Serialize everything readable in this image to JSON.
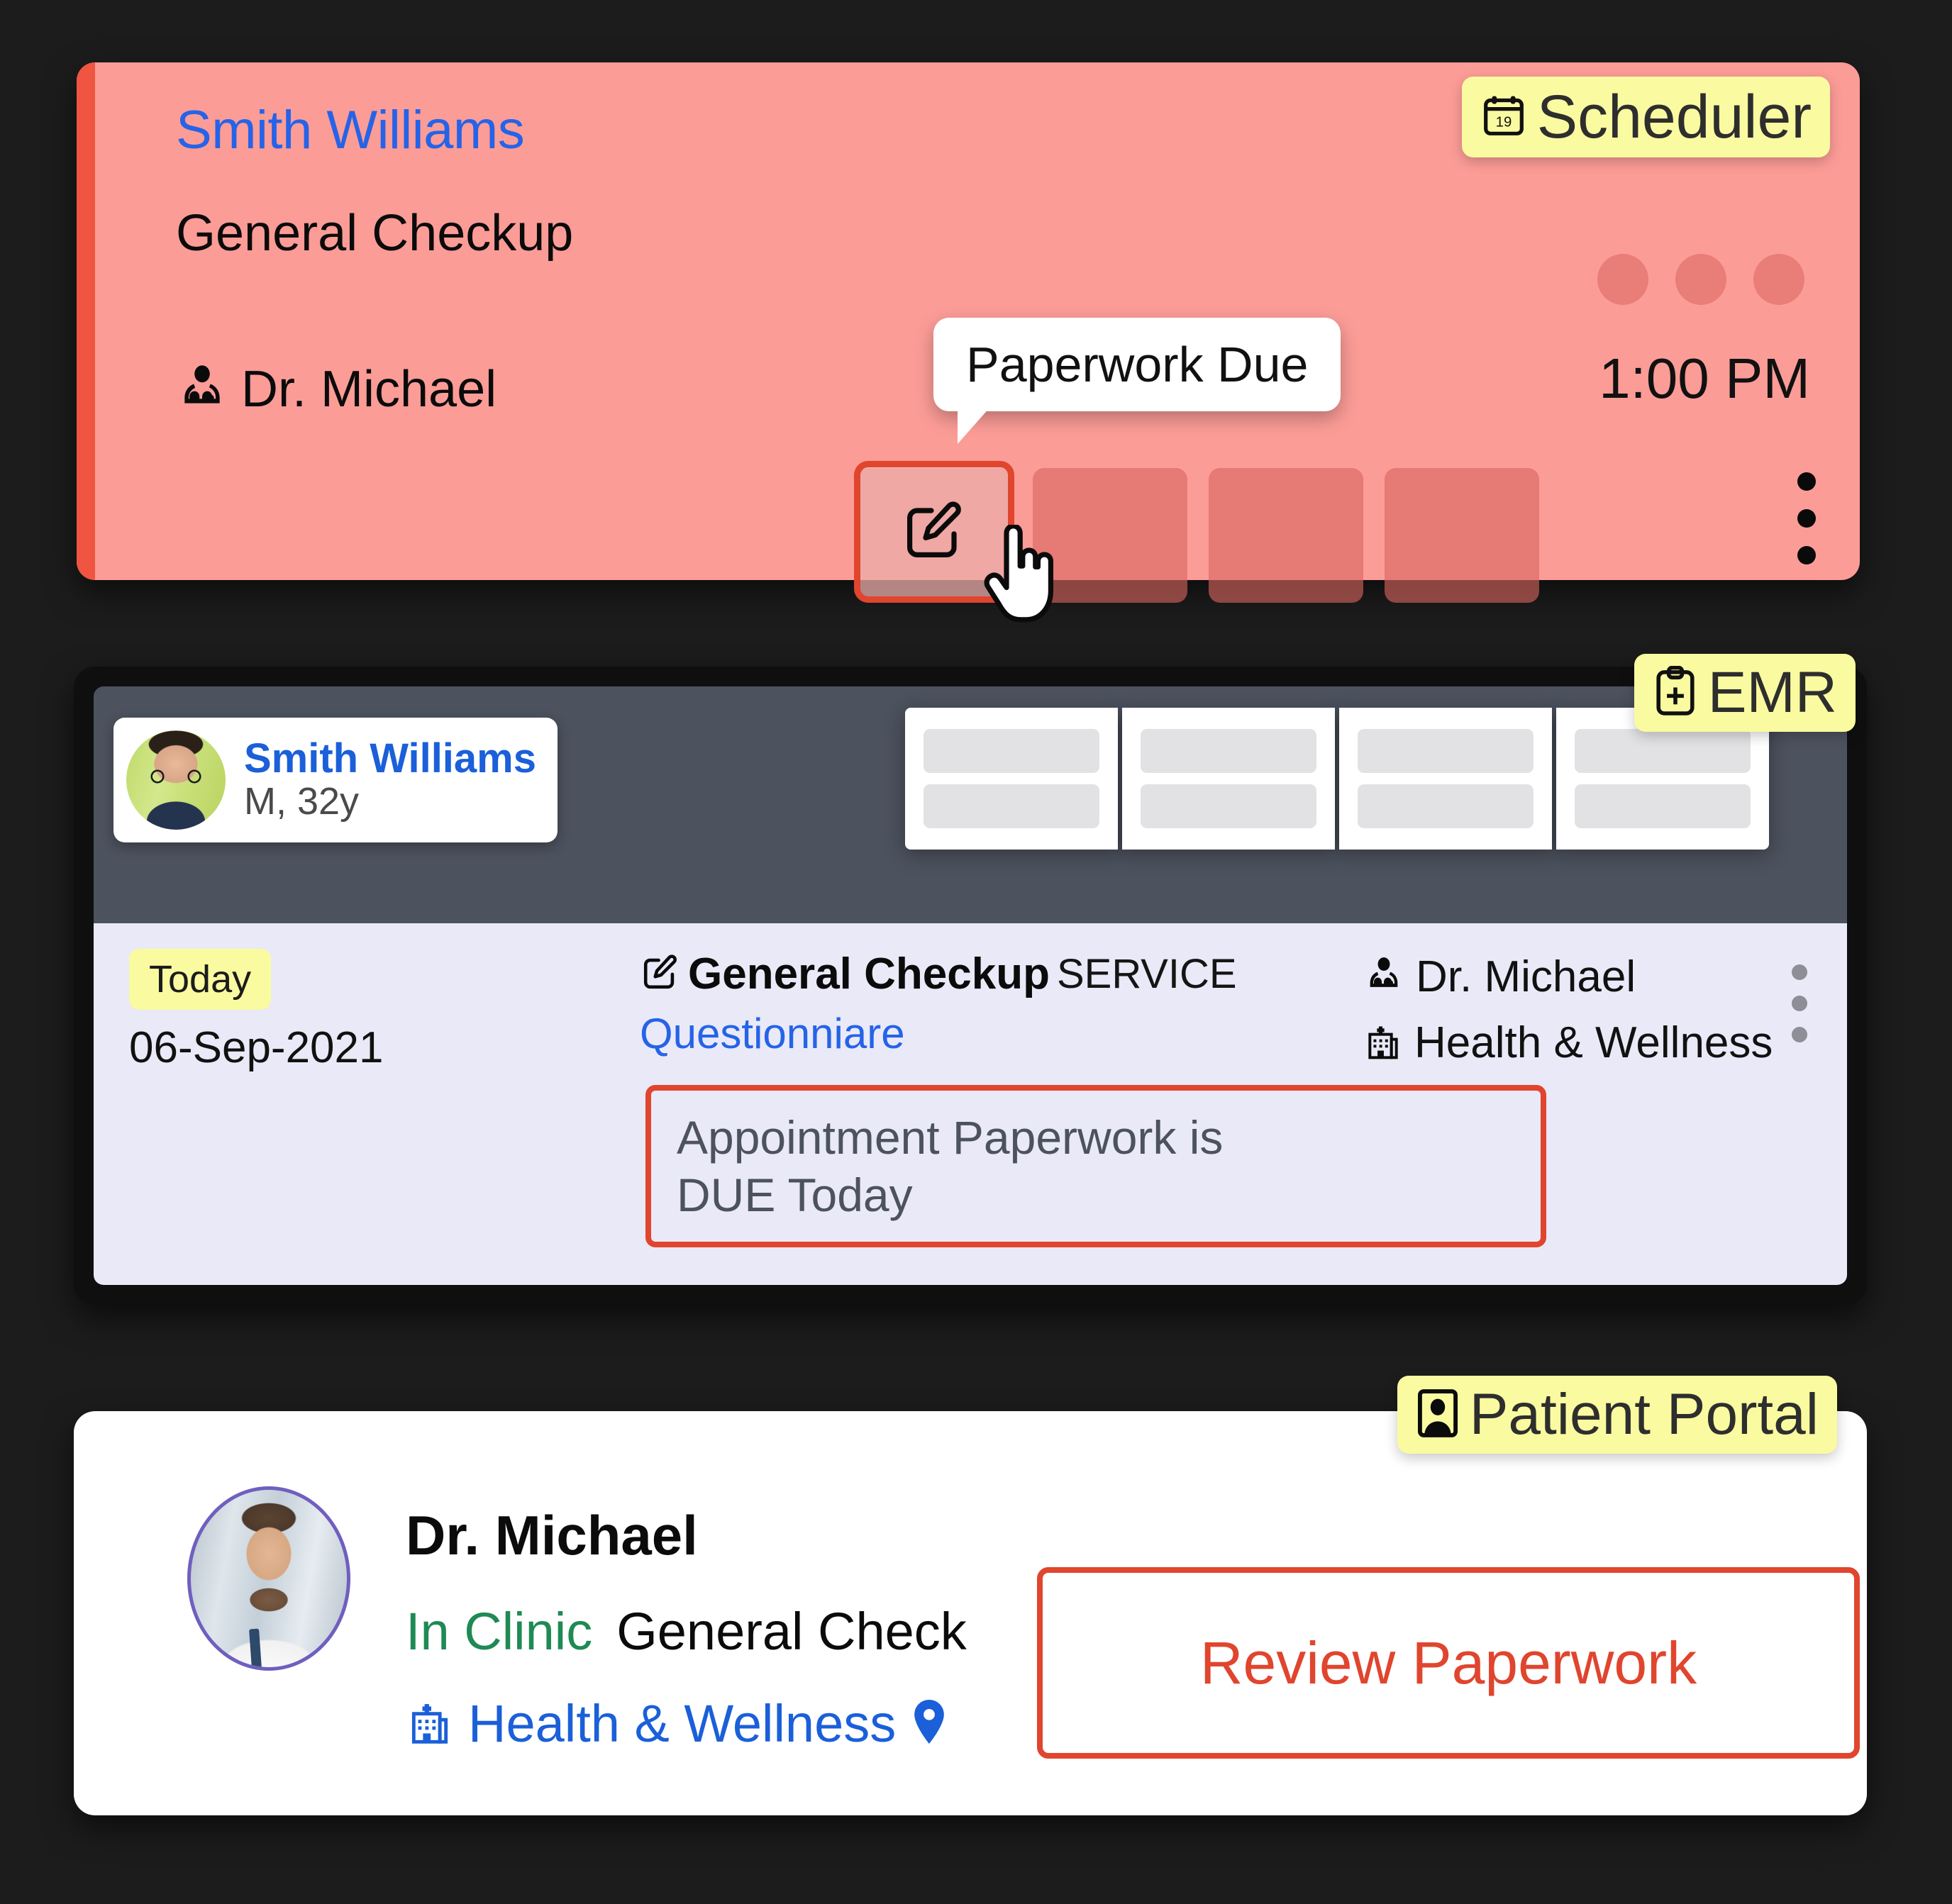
{
  "theme": {
    "page_background": "#1c1c1c",
    "scheduler_card_bg": "#FC9C97",
    "scheduler_accent": "#EF5540",
    "badge_bg": "#FAFAA0",
    "emr_header_bg": "#4C525E",
    "emr_body_bg": "#EAE9F7",
    "highlight_red": "#E0452E",
    "link_blue": "#2563E8",
    "green": "#1E8A54"
  },
  "scheduler": {
    "badge": {
      "label": "Scheduler",
      "icon": "calendar-icon",
      "calendar_day": "19"
    },
    "patient_name": "Smith Williams",
    "service": "General Checkup",
    "doctor": "Dr. Michael",
    "doctor_icon": "doctor-icon",
    "time": "1:00 PM",
    "tooltip": "Paperwork Due",
    "edit_button_icon": "edit-square-icon",
    "cursor": "hand-pointer-cursor",
    "ghost_placeholders": 3,
    "action_placeholders": 4,
    "kebab_icon": "kebab-menu-icon"
  },
  "emr": {
    "badge": {
      "label": "EMR",
      "icon": "medical-clipboard-icon"
    },
    "patient": {
      "name": "Smith Williams",
      "details": "M, 32y",
      "avatar": "patient-avatar"
    },
    "tabs": [
      {
        "bars": 2
      },
      {
        "bars": 2
      },
      {
        "bars": 2
      },
      {
        "bars": 2
      }
    ],
    "row": {
      "today_badge": "Today",
      "date": "06-Sep-2021",
      "service_name": "General Checkup",
      "service_type": "SERVICE",
      "service_icon": "edit-square-icon",
      "questionnaire_link": "Questionniare",
      "doctor": "Dr. Michael",
      "doctor_icon": "doctor-icon",
      "facility": "Health & Wellness",
      "facility_icon": "hospital-icon",
      "kebab_icon": "kebab-menu-icon"
    },
    "due_notice_line1": "Appointment Paperwork is",
    "due_notice_line2": "DUE Today"
  },
  "portal": {
    "badge": {
      "label": "Patient Portal",
      "icon": "id-card-person-icon"
    },
    "doctor_name": "Dr. Michael",
    "avatar": "doctor-avatar",
    "visit_mode": "In Clinic",
    "service": "General Check",
    "facility": "Health & Wellness",
    "facility_icon": "hospital-icon",
    "location_icon": "map-pin-icon",
    "review_callout": "Review Paperwork"
  }
}
